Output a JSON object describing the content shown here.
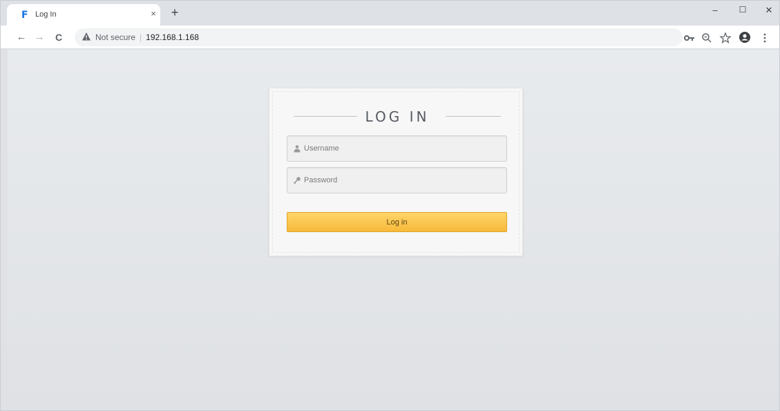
{
  "browser": {
    "tab": {
      "title": "Log In",
      "favicon_letter": "F",
      "close_glyph": "×"
    },
    "new_tab_glyph": "+",
    "window_controls": {
      "minimize": "–",
      "maximize": "☐",
      "close": "✕"
    },
    "nav": {
      "back": "←",
      "forward": "→",
      "reload": "C"
    },
    "omnibox": {
      "security_label": "Not secure",
      "separator": "|",
      "url": "192.168.1.168"
    },
    "toolbar_icons": [
      "key-icon",
      "zoom-icon",
      "star-icon",
      "profile-icon",
      "menu-icon"
    ]
  },
  "login": {
    "title": "LOG IN",
    "username_placeholder": "Username",
    "password_placeholder": "Password",
    "submit_label": "Log in"
  },
  "colors": {
    "accent": "#f7b93a",
    "accent_light": "#ffd56a",
    "page_bg": "#e3e5e8"
  }
}
